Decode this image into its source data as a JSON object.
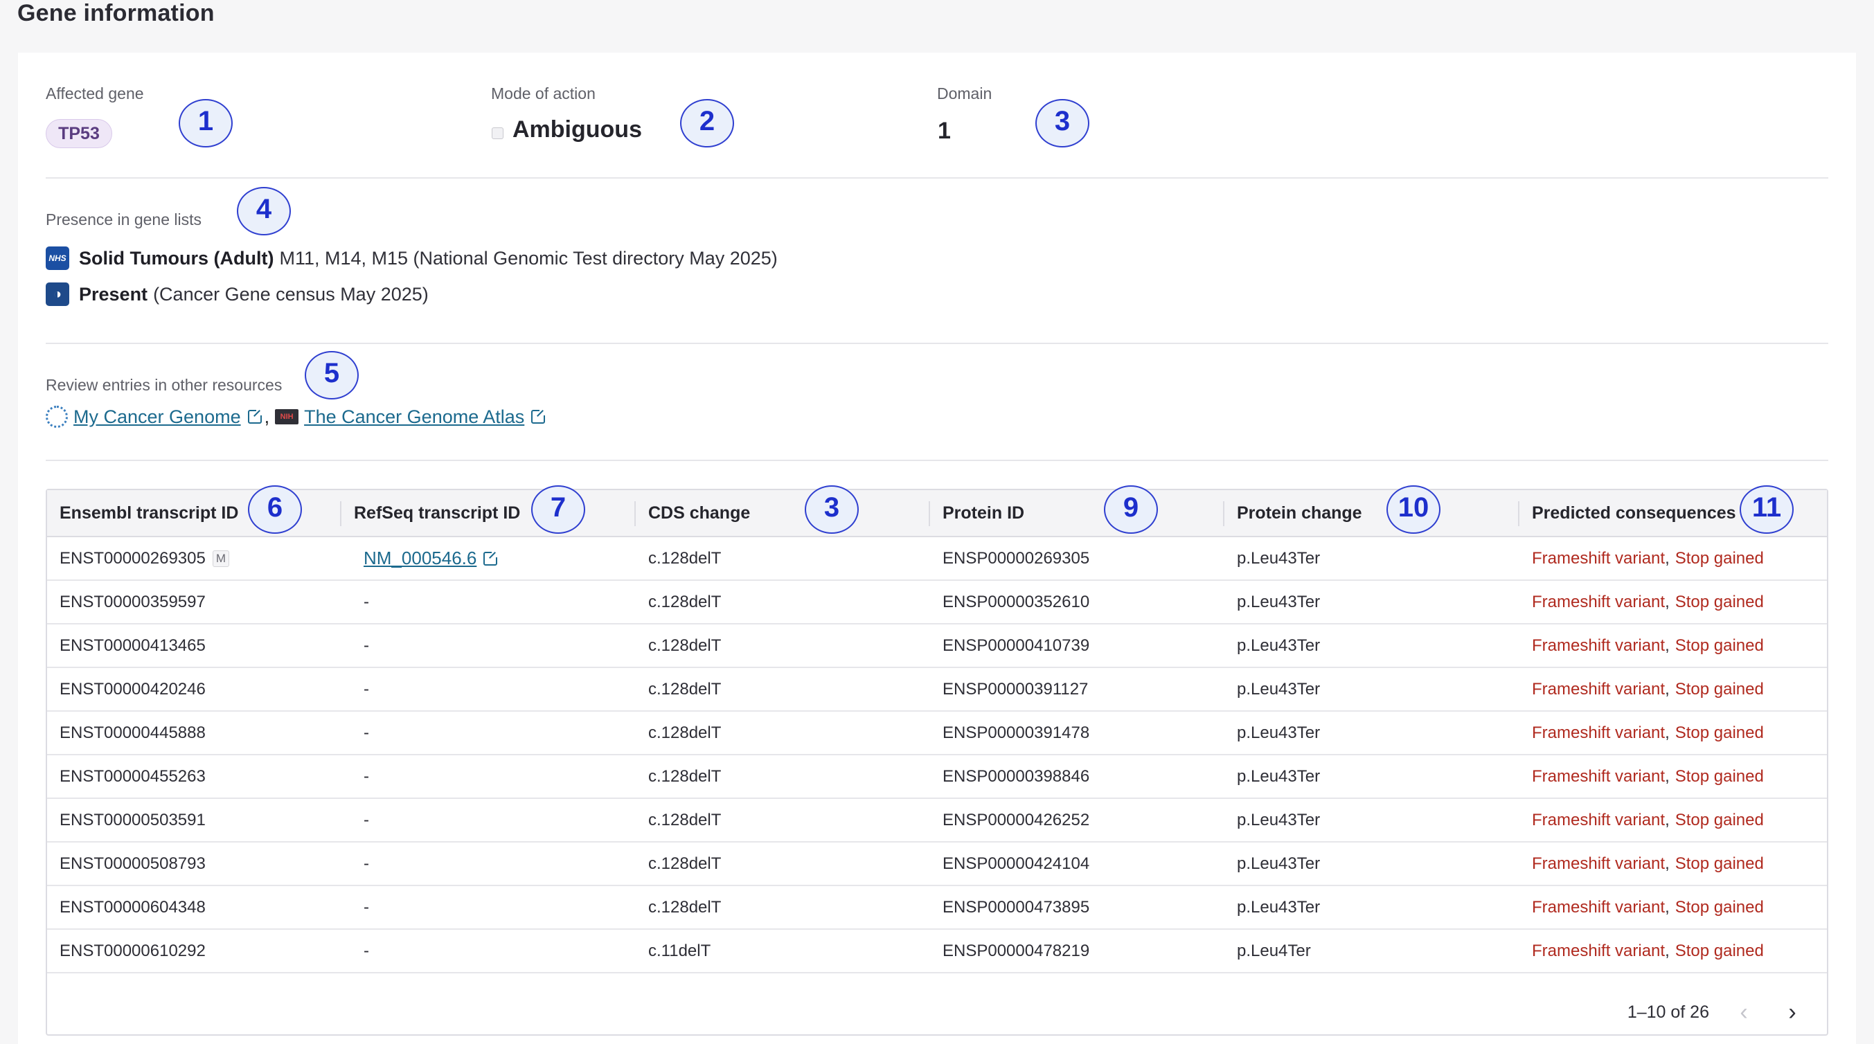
{
  "page": {
    "title": "Gene information"
  },
  "summary": {
    "affected_gene_label": "Affected gene",
    "affected_gene": "TP53",
    "mode_of_action_label": "Mode of action",
    "mode_of_action": "Ambiguous",
    "domain_label": "Domain",
    "domain": "1"
  },
  "gene_lists": {
    "label": "Presence in gene lists",
    "items": [
      {
        "icon": "nhs-icon",
        "icon_text": "NHS",
        "bold": "Solid Tumours (Adult)",
        "text": "M11, M14, M15 (National Genomic Test directory May 2025)"
      },
      {
        "icon": "cancer-gene-census-icon",
        "bold": "Present",
        "text": "(Cancer Gene census May 2025)"
      }
    ]
  },
  "resources": {
    "label": "Review entries in other resources",
    "links": [
      {
        "icon": "my-cancer-genome-icon",
        "label": "My Cancer Genome"
      },
      {
        "icon": "nih-tcga-icon",
        "icon_text": "NIH",
        "label": "The Cancer Genome Atlas"
      }
    ],
    "separator": ","
  },
  "callouts": [
    "1",
    "2",
    "3",
    "4",
    "5",
    "6",
    "7",
    "3",
    "9",
    "10",
    "11"
  ],
  "table": {
    "columns": [
      "Ensembl transcript ID",
      "RefSeq transcript ID",
      "CDS change",
      "Protein ID",
      "Protein change",
      "Predicted consequences"
    ],
    "rows": [
      {
        "ensembl": "ENST00000269305",
        "mane": "M",
        "refseq": "NM_000546.6",
        "cds": "c.128delT",
        "protein_id": "ENSP00000269305",
        "protein_change": "p.Leu43Ter",
        "consequences": [
          "Frameshift variant",
          "Stop gained"
        ]
      },
      {
        "ensembl": "ENST00000359597",
        "refseq": "-",
        "cds": "c.128delT",
        "protein_id": "ENSP00000352610",
        "protein_change": "p.Leu43Ter",
        "consequences": [
          "Frameshift variant",
          "Stop gained"
        ]
      },
      {
        "ensembl": "ENST00000413465",
        "refseq": "-",
        "cds": "c.128delT",
        "protein_id": "ENSP00000410739",
        "protein_change": "p.Leu43Ter",
        "consequences": [
          "Frameshift variant",
          "Stop gained"
        ]
      },
      {
        "ensembl": "ENST00000420246",
        "refseq": "-",
        "cds": "c.128delT",
        "protein_id": "ENSP00000391127",
        "protein_change": "p.Leu43Ter",
        "consequences": [
          "Frameshift variant",
          "Stop gained"
        ]
      },
      {
        "ensembl": "ENST00000445888",
        "refseq": "-",
        "cds": "c.128delT",
        "protein_id": "ENSP00000391478",
        "protein_change": "p.Leu43Ter",
        "consequences": [
          "Frameshift variant",
          "Stop gained"
        ]
      },
      {
        "ensembl": "ENST00000455263",
        "refseq": "-",
        "cds": "c.128delT",
        "protein_id": "ENSP00000398846",
        "protein_change": "p.Leu43Ter",
        "consequences": [
          "Frameshift variant",
          "Stop gained"
        ]
      },
      {
        "ensembl": "ENST00000503591",
        "refseq": "-",
        "cds": "c.128delT",
        "protein_id": "ENSP00000426252",
        "protein_change": "p.Leu43Ter",
        "consequences": [
          "Frameshift variant",
          "Stop gained"
        ]
      },
      {
        "ensembl": "ENST00000508793",
        "refseq": "-",
        "cds": "c.128delT",
        "protein_id": "ENSP00000424104",
        "protein_change": "p.Leu43Ter",
        "consequences": [
          "Frameshift variant",
          "Stop gained"
        ]
      },
      {
        "ensembl": "ENST00000604348",
        "refseq": "-",
        "cds": "c.128delT",
        "protein_id": "ENSP00000473895",
        "protein_change": "p.Leu43Ter",
        "consequences": [
          "Frameshift variant",
          "Stop gained"
        ]
      },
      {
        "ensembl": "ENST00000610292",
        "refseq": "-",
        "cds": "c.11delT",
        "protein_id": "ENSP00000478219",
        "protein_change": "p.Leu4Ter",
        "consequences": [
          "Frameshift variant",
          "Stop gained"
        ]
      }
    ],
    "consequence_separator": ","
  },
  "pagination": {
    "range": "1–10 of 26",
    "prev_icon": "chevron-left-icon",
    "next_icon": "chevron-right-icon"
  },
  "colors": {
    "link": "#1c6a8e",
    "consequence": "#b02a1f",
    "callout": "#1d2fcc",
    "gene_pill_bg": "#efe7f7"
  }
}
